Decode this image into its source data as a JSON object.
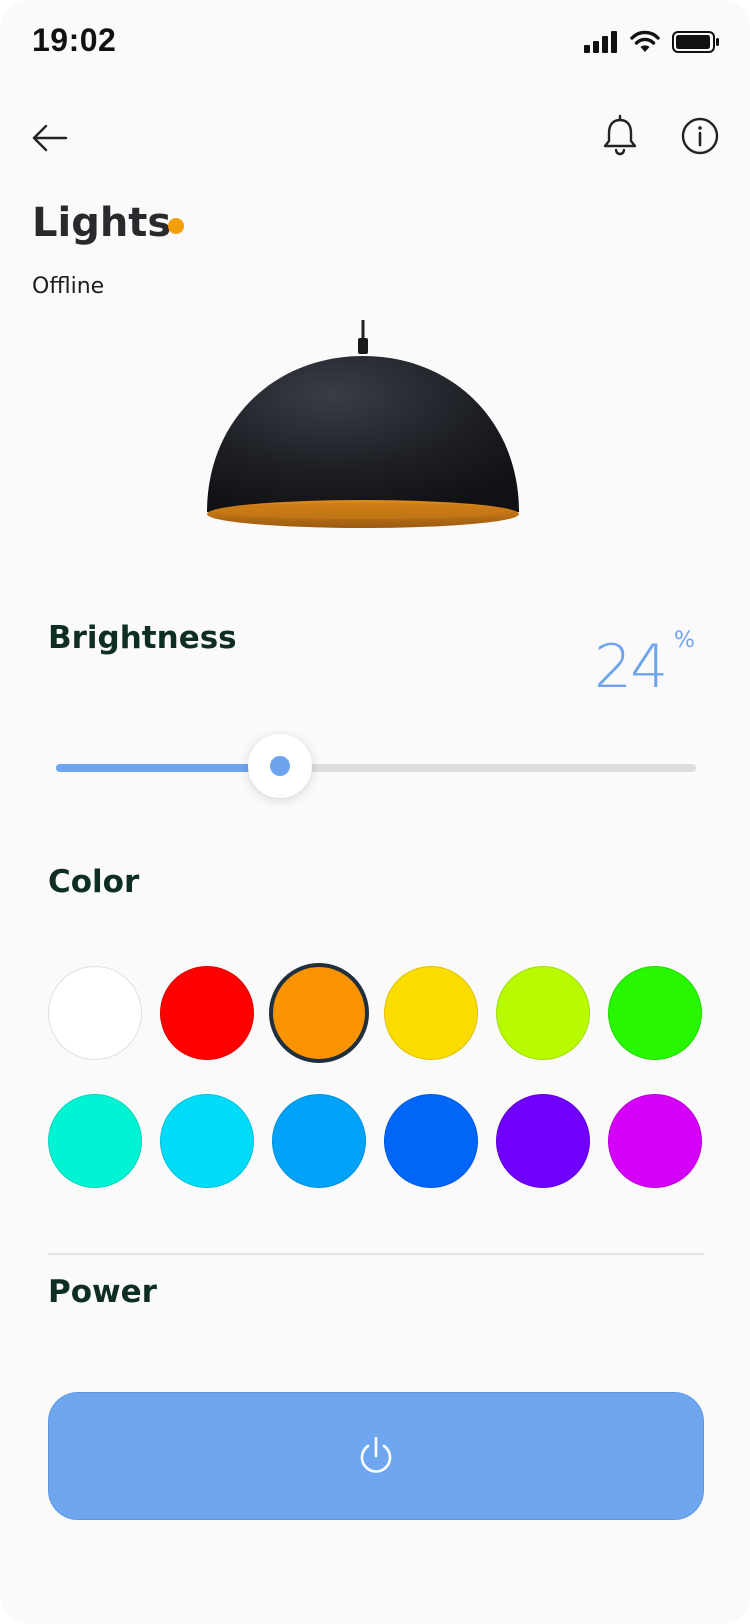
{
  "status_bar": {
    "time": "19:02",
    "icons": [
      "cellular-signal-icon",
      "wifi-icon",
      "battery-icon"
    ]
  },
  "header": {
    "back_icon": "arrow-left-icon",
    "notification_icon": "bell-icon",
    "info_icon": "info-circle-icon"
  },
  "device": {
    "name": "Lights",
    "status": "Offline",
    "status_dot_color": "#f59e0b",
    "image": "pendant-lamp"
  },
  "brightness": {
    "label": "Brightness",
    "value": "24",
    "unit": "%",
    "slider_fraction": 0.35,
    "accent": "#6ea3ee"
  },
  "color": {
    "label": "Color",
    "selected_index": 2,
    "options": [
      "#ffffff",
      "#ff0000",
      "#f99300",
      "#fbdc00",
      "#b8fb00",
      "#27f700",
      "#00f4d4",
      "#00dcf7",
      "#00a3f7",
      "#0066f9",
      "#6e00fb",
      "#d400f7"
    ]
  },
  "power": {
    "label": "Power",
    "icon": "power-icon",
    "button_color": "#6ea7ef"
  }
}
